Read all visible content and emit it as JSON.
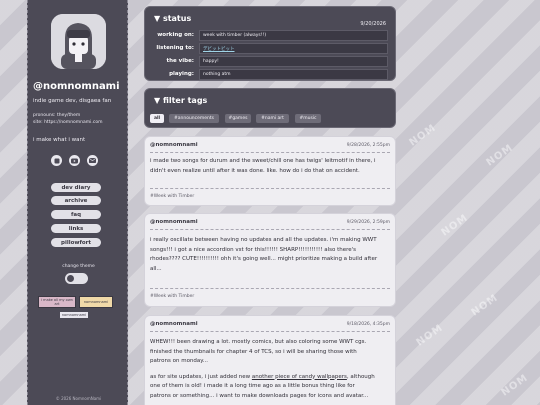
{
  "profile": {
    "username": "@nomnomnami",
    "bio": "indie game dev, disgaea fan",
    "pronouns": "pronouns: they/them",
    "site": "site: https://nomnomnami.com",
    "tagline": "i make what i want"
  },
  "nav": {
    "items": [
      {
        "label": "dev diary"
      },
      {
        "label": "archive"
      },
      {
        "label": "faq"
      },
      {
        "label": "links"
      },
      {
        "label": "pillowfort"
      }
    ]
  },
  "theme": {
    "label": "change theme"
  },
  "buttons": {
    "badge1": "i make all my own art",
    "badge2": "nomnomnami",
    "badge3": "nomnomnami"
  },
  "copyright": "© 2026 NomnomNami",
  "status": {
    "title": "status",
    "date": "9/20/2026",
    "rows": [
      {
        "label": "working on:",
        "value": "week with timber (always!!)",
        "link": false
      },
      {
        "label": "listening to:",
        "value": "デビットビット",
        "link": true
      },
      {
        "label": "the vibe:",
        "value": "happy!",
        "link": false
      },
      {
        "label": "playing:",
        "value": "nothing atm",
        "link": false
      }
    ]
  },
  "filter": {
    "title": "filter tags",
    "tags": [
      "all",
      "#announcements",
      "#games",
      "#nami art",
      "#music"
    ]
  },
  "posts": [
    {
      "user": "@nomnomnami",
      "date": "9/28/2026, 2:55pm",
      "lines": [
        "i made two songs for durum and the sweet/chill one has twigs' leitmotif in there, i",
        "didn't even realize until after it was done. like. how do i do that on accident."
      ],
      "tag": "#Week with Timber"
    },
    {
      "user": "@nomnomnami",
      "date": "9/29/2026, 2:59pm",
      "lines": [
        "i really oscillate between having no updates and all the updates. i'm making WWT",
        "songs!!! i got a nice accordion vst for this!!!!!! SHARP!!!!!!!!!!! also there's",
        "rhodes???? CUTE!!!!!!!!!! ohh it's going well... might prioritize making a build after",
        "all..."
      ],
      "tag": "#Week with Timber"
    },
    {
      "user": "@nomnomnami",
      "date": "9/18/2026, 4:35pm",
      "lines": [
        "WHEW!!! been drawing a lot. mostly comics, but also coloring some WWT cgs.",
        "finished the thumbnails for chapter 4 of TCS, so i will be sharing those with",
        "patrons on monday..."
      ],
      "lines2_pre": "as for site updates, i just added new ",
      "lines2_link": "another piece of candy wallpapers",
      "lines2_post": ", although",
      "lines3": [
        "one of them is old! i made it a long time ago as a little bonus thing like for",
        "patrons or something... i want to make downloads pages for icons and avatar..."
      ]
    }
  ],
  "watermark": "NOM",
  "colors": {
    "sidebar": "#4c4a56",
    "background": "#c9c7cf",
    "card": "#efeef2",
    "link": "#9fd3e6"
  }
}
